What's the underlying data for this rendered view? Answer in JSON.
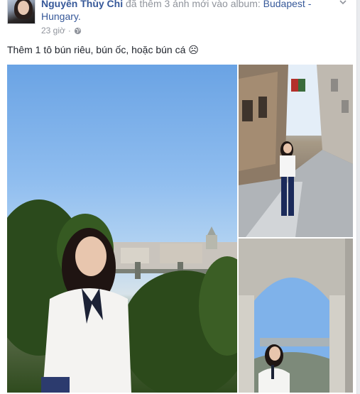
{
  "post": {
    "author_name": "Nguyễn Thùy Chi",
    "action_text": "đã thêm 3 ảnh mới vào album:",
    "album_name": "Budapest - Hungary.",
    "timestamp": "23 giờ",
    "separator": "·",
    "privacy_icon": "globe-icon",
    "caption": "Thêm 1 tô bún riêu, bún ốc, hoặc bún cá ☹",
    "photo_count": 3
  },
  "colors": {
    "link": "#365899",
    "text": "#1d2129",
    "muted": "#90949c",
    "background": "#e9ebee"
  }
}
